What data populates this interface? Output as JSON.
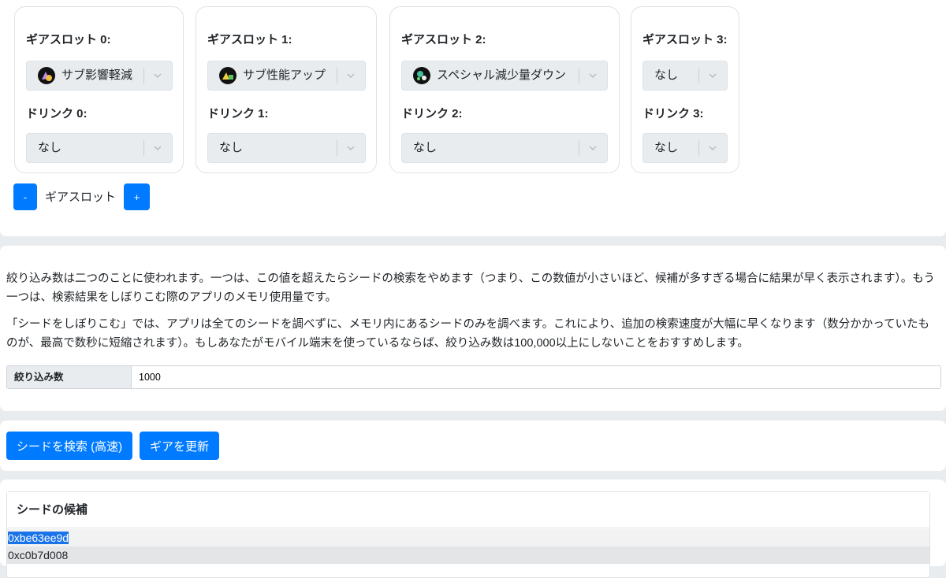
{
  "gear_slots": [
    {
      "slot_label": "ギアスロット 0:",
      "gear_value": "サブ影響軽減",
      "gear_icon": "sub-power-down-icon",
      "drink_label": "ドリンク 0:",
      "drink_value": "なし"
    },
    {
      "slot_label": "ギアスロット 1:",
      "gear_value": "サブ性能アップ",
      "gear_icon": "sub-power-up-icon",
      "drink_label": "ドリンク 1:",
      "drink_value": "なし"
    },
    {
      "slot_label": "ギアスロット 2:",
      "gear_value": "スペシャル減少量ダウン",
      "gear_icon": "special-saver-icon",
      "drink_label": "ドリンク 2:",
      "drink_value": "なし"
    },
    {
      "slot_label": "ギアスロット 3:",
      "gear_value": "なし",
      "gear_icon": "",
      "drink_label": "ドリンク 3:",
      "drink_value": "なし"
    }
  ],
  "slot_controls": {
    "minus_label": "-",
    "label": "ギアスロット",
    "plus_label": "+"
  },
  "description": {
    "para1": "絞り込み数は二つのことに使われます。一つは、この値を超えたらシードの検索をやめます（つまり、この数値が小さいほど、候補が多すぎる場合に結果が早く表示されます）。もう一つは、検索結果をしぼりこむ際のアプリのメモリ使用量です。",
    "para2": "「シードをしぼりこむ」では、アプリは全てのシードを調べずに、メモリ内にあるシードのみを調べます。これにより、追加の検索速度が大幅に早くなります（数分かかっていたものが、最高で数秒に短縮されます）。もしあなたがモバイル端末を使っているならば、絞り込み数は100,000以上にしないことをおすすめします。"
  },
  "limit": {
    "label": "絞り込み数",
    "value": "1000"
  },
  "actions": {
    "search_label": "シードを検索 (高速)",
    "update_label": "ギアを更新"
  },
  "results": {
    "header": "シードの候補",
    "seeds": [
      "0xbe63ee9d",
      "0xc0b7d008"
    ]
  },
  "colors": {
    "accent": "#007bff",
    "selection": "#1a73e8"
  }
}
